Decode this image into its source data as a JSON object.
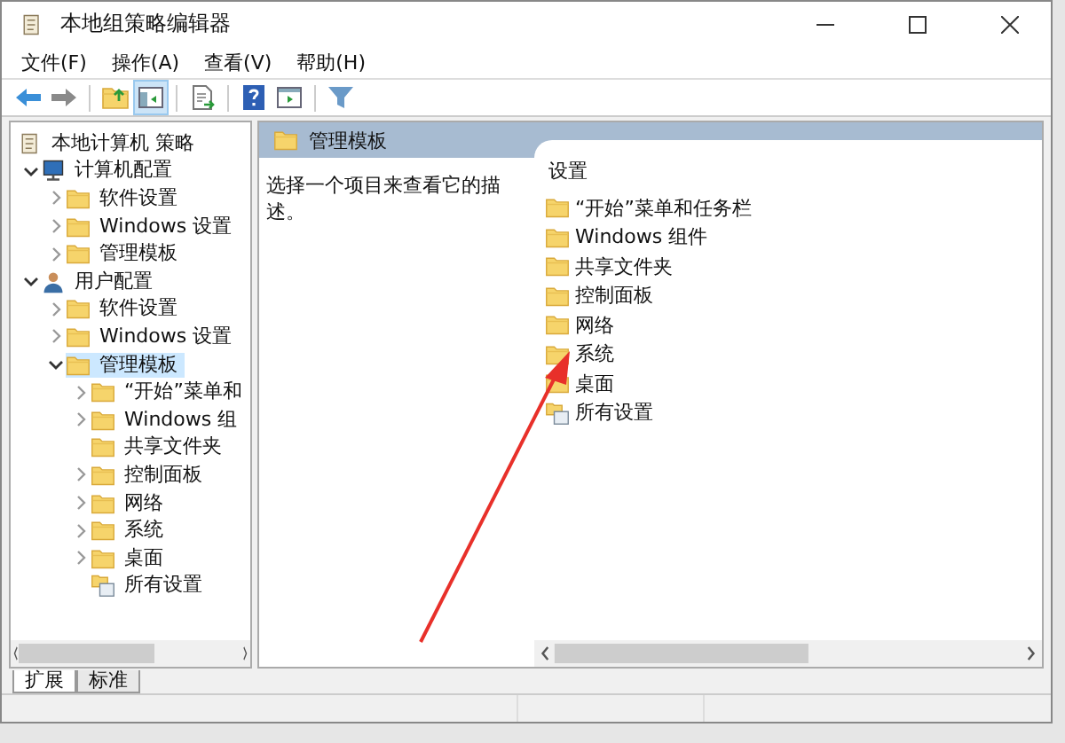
{
  "window": {
    "title": "本地组策略编辑器"
  },
  "menu": [
    "文件(F)",
    "操作(A)",
    "查看(V)",
    "帮助(H)"
  ],
  "tree": {
    "label": "本地计算机 策略",
    "kind": "policy",
    "selected": false,
    "children": [
      {
        "label": "计算机配置",
        "kind": "computer",
        "has_children": true,
        "expanded": true,
        "selected": false,
        "children": [
          {
            "label": "软件设置",
            "kind": "folder",
            "has_children": true,
            "expanded": false,
            "selected": false
          },
          {
            "label": "Windows 设置",
            "kind": "folder",
            "has_children": true,
            "expanded": false,
            "selected": false
          },
          {
            "label": "管理模板",
            "kind": "folder",
            "has_children": true,
            "expanded": false,
            "selected": false
          }
        ]
      },
      {
        "label": "用户配置",
        "kind": "user",
        "has_children": true,
        "expanded": true,
        "selected": false,
        "children": [
          {
            "label": "软件设置",
            "kind": "folder",
            "has_children": true,
            "expanded": false,
            "selected": false
          },
          {
            "label": "Windows 设置",
            "kind": "folder",
            "has_children": true,
            "expanded": false,
            "selected": false
          },
          {
            "label": "管理模板",
            "kind": "folder",
            "has_children": true,
            "expanded": true,
            "selected": true,
            "children": [
              {
                "label": "“开始”菜单和",
                "kind": "folder",
                "has_children": true,
                "expanded": false,
                "selected": false
              },
              {
                "label": "Windows 组",
                "kind": "folder",
                "has_children": true,
                "expanded": false,
                "selected": false
              },
              {
                "label": "共享文件夹",
                "kind": "folder",
                "has_children": false,
                "expanded": false,
                "selected": false
              },
              {
                "label": "控制面板",
                "kind": "folder",
                "has_children": true,
                "expanded": false,
                "selected": false
              },
              {
                "label": "网络",
                "kind": "folder",
                "has_children": true,
                "expanded": false,
                "selected": false
              },
              {
                "label": "系统",
                "kind": "folder",
                "has_children": true,
                "expanded": false,
                "selected": false
              },
              {
                "label": "桌面",
                "kind": "folder",
                "has_children": true,
                "expanded": false,
                "selected": false
              },
              {
                "label": "所有设置",
                "kind": "all",
                "has_children": false,
                "expanded": false,
                "selected": false
              }
            ]
          }
        ]
      }
    ]
  },
  "details": {
    "header": "管理模板",
    "description": "选择一个项目来查看它的描述。",
    "column": "设置",
    "items": [
      {
        "label": "“开始”菜单和任务栏",
        "kind": "folder"
      },
      {
        "label": "Windows 组件",
        "kind": "folder"
      },
      {
        "label": "共享文件夹",
        "kind": "folder"
      },
      {
        "label": "控制面板",
        "kind": "folder"
      },
      {
        "label": "网络",
        "kind": "folder"
      },
      {
        "label": "系统",
        "kind": "folder"
      },
      {
        "label": "桌面",
        "kind": "folder"
      },
      {
        "label": "所有设置",
        "kind": "all"
      }
    ]
  },
  "tabs": [
    {
      "label": "扩展",
      "selected": true
    },
    {
      "label": "标准",
      "selected": false
    }
  ]
}
